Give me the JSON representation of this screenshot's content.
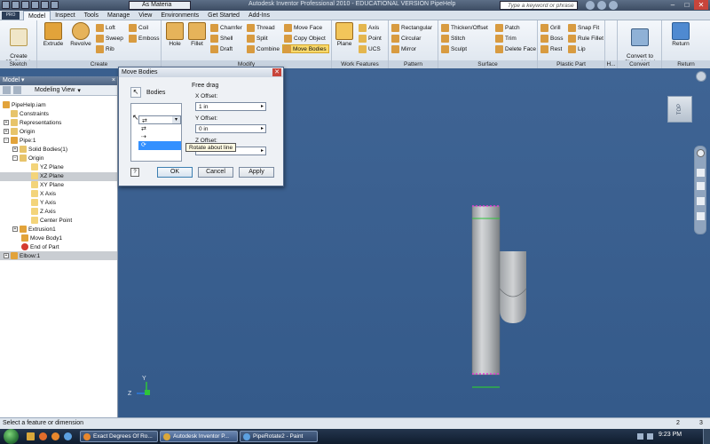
{
  "window": {
    "material": "As Materia",
    "title": "Autodesk Inventor Professional 2010 - EDUCATIONAL VERSION    PipeHelp",
    "search_placeholder": "Type a keyword or phrase"
  },
  "tabs": {
    "pro": "PRO",
    "items": [
      "Model",
      "Inspect",
      "Tools",
      "Manage",
      "View",
      "Environments",
      "Get Started",
      "Add-Ins"
    ],
    "active": "Model"
  },
  "ribbon": {
    "sketch": {
      "label": "Sketch",
      "create": "Create\n2D Sketch"
    },
    "create": {
      "label": "Create",
      "extrude": "Extrude",
      "revolve": "Revolve",
      "loft": "Loft",
      "coil": "Coil",
      "sweep": "Sweep",
      "emboss": "Emboss",
      "rib": "Rib"
    },
    "modify": {
      "label": "Modify",
      "hole": "Hole",
      "fillet": "Fillet",
      "chamfer": "Chamfer",
      "thread": "Thread",
      "shell": "Shell",
      "split": "Split",
      "draft": "Draft",
      "combine": "Combine",
      "moveface": "Move Face",
      "copyobject": "Copy Object",
      "movebodies": "Move Bodies"
    },
    "workfeatures": {
      "label": "Work Features",
      "plane": "Plane",
      "axis": "Axis",
      "point": "Point",
      "ucs": "UCS"
    },
    "pattern": {
      "label": "Pattern",
      "rectangular": "Rectangular",
      "circular": "Circular",
      "mirror": "Mirror"
    },
    "surface": {
      "label": "Surface",
      "thicken": "Thicken/Offset",
      "stitch": "Stitch",
      "sculpt": "Sculpt",
      "patch": "Patch",
      "trim": "Trim",
      "deleteface": "Delete Face"
    },
    "plastic": {
      "label": "Plastic Part",
      "grill": "Grill",
      "boss": "Boss",
      "rest": "Rest",
      "snapfit": "Snap Fit",
      "rulefillet": "Rule Fillet",
      "lip": "Lip"
    },
    "h": {
      "label": "H..."
    },
    "convert": {
      "label": "Convert",
      "sheetmetal": "Convert to\nSheet Metal"
    },
    "return": {
      "label": "Return",
      "btn": "Return"
    }
  },
  "browser": {
    "header": "Model",
    "view": "Modeling View",
    "items": [
      {
        "label": "PipeHelp.iam"
      },
      {
        "label": "Constraints"
      },
      {
        "label": "Representations"
      },
      {
        "label": "Origin"
      },
      {
        "label": "Pipe:1"
      },
      {
        "label": "Solid Bodies(1)"
      },
      {
        "label": "Origin"
      },
      {
        "label": "YZ Plane"
      },
      {
        "label": "XZ Plane"
      },
      {
        "label": "XY Plane"
      },
      {
        "label": "X Axis"
      },
      {
        "label": "Y Axis"
      },
      {
        "label": "Z Axis"
      },
      {
        "label": "Center Point"
      },
      {
        "label": "Extrusion1"
      },
      {
        "label": "Move Body1"
      },
      {
        "label": "End of Part"
      },
      {
        "label": "Elbow:1"
      }
    ]
  },
  "dialog": {
    "title": "Move Bodies",
    "bodies": "Bodies",
    "freedrag": "Free drag",
    "xoffset_label": "X Offset:",
    "xoffset": "1 in",
    "yoffset_label": "Y Offset:",
    "yoffset": "0 in",
    "zoffset_label": "Z Offset:",
    "tooltip": "Rotate about line",
    "ok": "OK",
    "cancel": "Cancel",
    "apply": "Apply"
  },
  "viewcube": {
    "face": "TOP"
  },
  "status": {
    "text": "Select a feature or dimension",
    "num1": "2",
    "num2": "3"
  },
  "taskbar": {
    "tasks": [
      "Exact Degrees Of Ro...",
      "Autodesk Inventor P...",
      "PipeRotate2 - Paint"
    ],
    "time": "9:23 PM"
  },
  "colors": {
    "viewport": "#3a5f8e",
    "selection": "#f9d96b",
    "accent": "#4e6482"
  }
}
